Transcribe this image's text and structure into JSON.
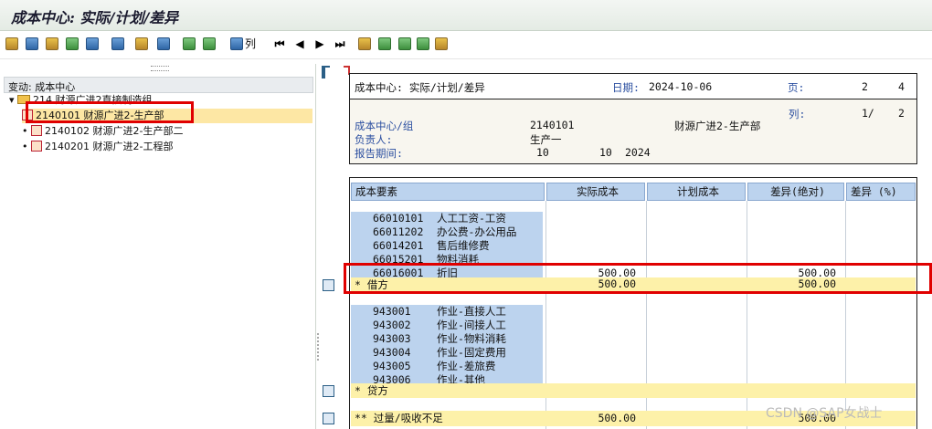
{
  "window": {
    "title": "成本中心: 实际/计划/差异"
  },
  "toolbar": {
    "columns_label": "列"
  },
  "left": {
    "header": "变动: 成本中心",
    "tree": [
      {
        "label": "214 财源广进2直接制造组"
      },
      {
        "label": "2140101 财源广进2-生产部"
      },
      {
        "label": "2140102 财源广进2-生产部二"
      },
      {
        "label": "2140201 财源广进2-工程部"
      }
    ]
  },
  "report": {
    "title": "成本中心: 实际/计划/差异",
    "date_label": "日期:",
    "date": "2024-10-06",
    "page_label": "页:",
    "page": "2",
    "pages": "4",
    "col_label": "列:",
    "col": "1/",
    "cols": "2",
    "cc_label": "成本中心/组",
    "cc_value": "2140101",
    "cc_name": "财源广进2-生产部",
    "resp_label": "负责人:",
    "resp_value": "生产一",
    "period_label": "报告期间:",
    "period_from": "10",
    "period_to": "10",
    "period_year": "2024",
    "headers": [
      "成本要素",
      "实际成本",
      "计划成本",
      "差异(绝对)",
      "差异 (%)"
    ],
    "group1": [
      {
        "code": "66010101",
        "name": "人工工资-工资",
        "actual": "",
        "var": ""
      },
      {
        "code": "66011202",
        "name": "办公费-办公用品",
        "actual": "",
        "var": ""
      },
      {
        "code": "66014201",
        "name": "售后维修费",
        "actual": "",
        "var": ""
      },
      {
        "code": "66015201",
        "name": "物料消耗",
        "actual": "",
        "var": ""
      },
      {
        "code": "66016001",
        "name": "折旧",
        "actual": "500.00",
        "var": "500.00"
      }
    ],
    "debit": {
      "label": "*  借方",
      "actual": "500.00",
      "var": "500.00"
    },
    "group2": [
      {
        "code": "943001",
        "name": "作业-直接人工"
      },
      {
        "code": "943002",
        "name": "作业-间接人工"
      },
      {
        "code": "943003",
        "name": "作业-物料消耗"
      },
      {
        "code": "943004",
        "name": "作业-固定费用"
      },
      {
        "code": "943005",
        "name": "作业-差旅费"
      },
      {
        "code": "943006",
        "name": "作业-其他"
      }
    ],
    "credit": {
      "label": "*  贷方"
    },
    "over": {
      "label": "** 过量/吸收不足",
      "actual": "500.00",
      "var": "500.00"
    }
  },
  "watermark": "CSDN @SAP女战士"
}
